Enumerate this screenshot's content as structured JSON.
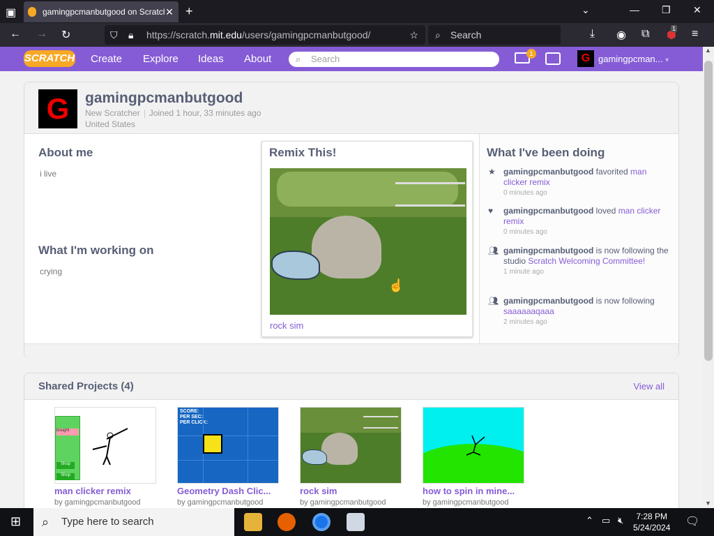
{
  "browser": {
    "tab_title": "gamingpcmanbutgood on Scratch",
    "new_tab": "+",
    "url_prefix": "https://scratch.",
    "url_domain": "mit.edu",
    "url_path": "/users/gamingpcmanbutgood/",
    "search_label": "Search",
    "notif_count": "1"
  },
  "scratch_nav": {
    "logo": "SCRATCH",
    "items": [
      "Create",
      "Explore",
      "Ideas",
      "About"
    ],
    "search_placeholder": "Search",
    "message_count": "1",
    "username": "gamingpcman..."
  },
  "profile": {
    "username": "gamingpcmanbutgood",
    "rank": "New Scratcher",
    "joined": "Joined 1 hour, 33 minutes ago",
    "location": "United States",
    "avatar_letter": "G"
  },
  "about": {
    "title": "About me",
    "text": "i live"
  },
  "working": {
    "title": "What I'm working on",
    "text": "crying"
  },
  "remix": {
    "title": "Remix This!",
    "project": "rock sim"
  },
  "activity": {
    "title": "What I've been doing",
    "items": [
      {
        "icon": "star",
        "user": "gamingpcmanbutgood",
        "action": " favorited ",
        "target": "man clicker remix",
        "ago": "0 minutes ago"
      },
      {
        "icon": "heart",
        "user": "gamingpcmanbutgood",
        "action": " loved ",
        "target": "man clicker remix",
        "ago": "0 minutes ago"
      },
      {
        "icon": "people",
        "user": "gamingpcmanbutgood",
        "action": " is now following the studio ",
        "target": "Scratch Welcoming Committee!",
        "ago": "1 minute ago"
      },
      {
        "icon": "people",
        "user": "gamingpcmanbutgood",
        "action": " is now following ",
        "target": "saaaaaaqaaa",
        "ago": "2 minutes ago"
      }
    ]
  },
  "shared": {
    "title": "Shared Projects (4)",
    "view_all": "View all",
    "projects": [
      {
        "title": "man clicker remix",
        "by": "by gamingpcmanbutgood",
        "thumb_text1": "bought",
        "thumb_text2": "Shop",
        "thumb_text3": "Shop"
      },
      {
        "title": "Geometry Dash Clic...",
        "by": "by gamingpcmanbutgood",
        "thumb_text1": "SCORE:",
        "thumb_text2": "PER SEC:",
        "thumb_text3": "PER CLICK:"
      },
      {
        "title": "rock sim",
        "by": "by gamingpcmanbutgood"
      },
      {
        "title": "how to spin in mine...",
        "by": "by gamingpcmanbutgood"
      }
    ]
  },
  "taskbar": {
    "search_placeholder": "Type here to search",
    "time": "7:28 PM",
    "date": "5/24/2024"
  },
  "colors": {
    "scratch_purple": "#855cd6",
    "browser_bg": "#1c1b22"
  }
}
